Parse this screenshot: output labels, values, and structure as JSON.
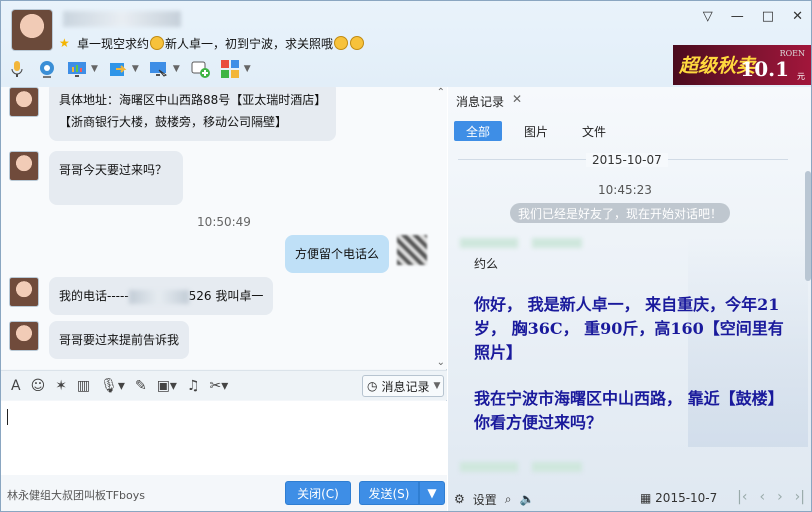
{
  "header": {
    "signature": "卓一现空求约",
    "signature_tail": "新人卓一，初到宁波，求关照哦",
    "window_buttons": [
      "▽",
      "—",
      "□",
      "✕"
    ]
  },
  "ad": {
    "brand": "ROEN",
    "promo": "超级秋卖",
    "price": "10.1",
    "unit": "元"
  },
  "chat": {
    "messages": [
      {
        "type": "left",
        "lines": [
          "具体地址：海曙区中山西路88号【亚太瑞时酒店】",
          "【浙商银行大楼，鼓楼旁，移动公司隔壁】"
        ]
      },
      {
        "type": "left",
        "lines": [
          "哥哥今天要过来吗？"
        ]
      },
      {
        "type": "time",
        "text": "10:50:49"
      },
      {
        "type": "right",
        "lines": [
          "方便留个电话么"
        ]
      },
      {
        "type": "left",
        "lines": [
          "我的电话-----",
          "526    我叫卓一"
        ]
      },
      {
        "type": "left",
        "lines": [
          "哥哥要过来提前告诉我"
        ]
      }
    ]
  },
  "input": {
    "history_label": "消息记录",
    "footer_ad": "林永健组大叔团叫板TFboys",
    "close_label": "关闭(C)",
    "send_label": "发送(S)"
  },
  "history": {
    "tab_title": "消息记录",
    "filters": [
      "全部",
      "图片",
      "文件"
    ],
    "date": "2015-10-07",
    "time": "10:45:23",
    "system_msg": "我们已经是好友了，现在开始对话吧！",
    "msg1": "约么",
    "msg2": "你好， 我是新人卓一， 来自重庆，今年21岁， 胸36C， 重90斤，高160【空间里有照片】",
    "msg3": "我在宁波市海曙区中山西路， 靠近【鼓楼】你看方便过来吗？",
    "footer_settings": "设置",
    "footer_date": "2015-10-7"
  },
  "colors": {
    "accent": "#3e8ee6",
    "bubble_left": "#e6ebf1",
    "bubble_right": "#bfe0f7",
    "history_text": "#1a1a9c"
  }
}
